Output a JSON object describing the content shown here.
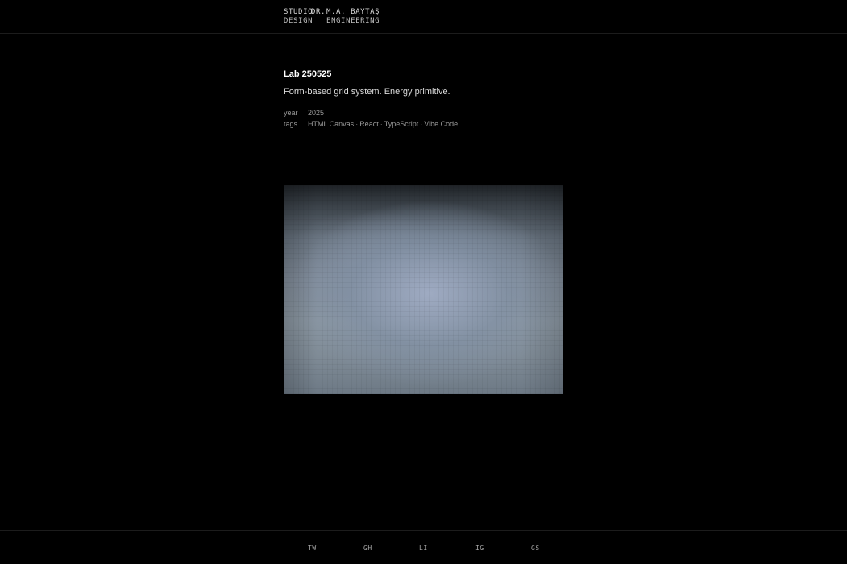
{
  "header": {
    "brand_line1": [
      "STUDIO",
      "DR.",
      "M.A. BAYTAŞ"
    ],
    "brand_line2": [
      "DESIGN",
      "",
      "ENGINEERING"
    ]
  },
  "lab": {
    "title": "Lab 250525",
    "description": "Form-based grid system. Energy primitive.",
    "year_label": "year",
    "year_value": "2025",
    "tags_label": "tags",
    "tags": [
      "HTML Canvas",
      "React",
      "TypeScript",
      "Vibe Code"
    ],
    "separator": "·"
  },
  "canvas": {
    "colors": [
      "#1e2226",
      "#66717d",
      "#8a96a1",
      "#a0acc4"
    ]
  },
  "footer": {
    "links": [
      "TW",
      "GH",
      "LI",
      "IG",
      "GS"
    ]
  }
}
